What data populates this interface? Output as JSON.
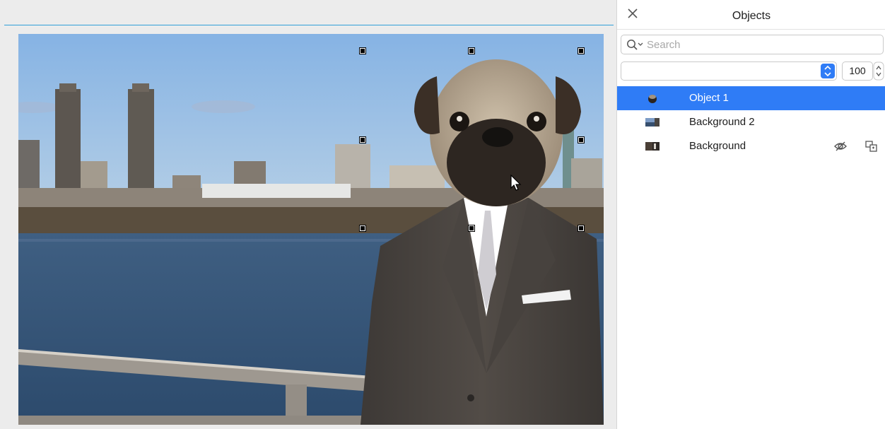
{
  "panel": {
    "title": "Objects",
    "close_icon": "close-icon",
    "search": {
      "placeholder": "Search",
      "value": ""
    },
    "blend_mode": {
      "value": ""
    },
    "opacity": {
      "value": "100"
    }
  },
  "layers": [
    {
      "name": "Object 1",
      "selected": true,
      "thumb": "pug-thumbnail"
    },
    {
      "name": "Background 2",
      "selected": false,
      "thumb": "skyline-thumbnail"
    },
    {
      "name": "Background",
      "selected": false,
      "thumb": "suit-thumbnail",
      "icons": [
        "visibility-icon",
        "lock-icon"
      ]
    }
  ],
  "colors": {
    "accent": "#2f7cf6",
    "selection_line": "#2fa0d8",
    "panel_bg": "#ffffff",
    "canvas_bg": "#ececec"
  }
}
